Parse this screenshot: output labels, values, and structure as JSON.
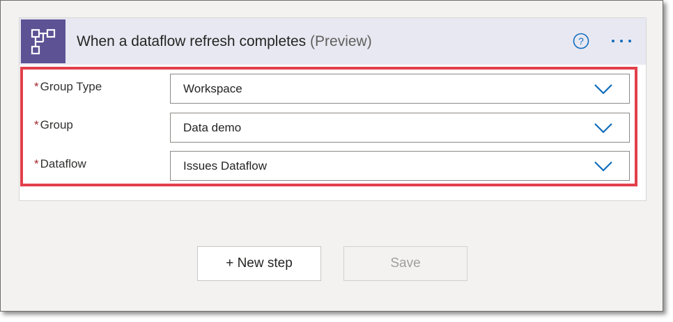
{
  "trigger": {
    "title": "When a dataflow refresh completes",
    "suffix": "(Preview)",
    "icon": "dataflow-hierarchy-icon",
    "icon_bg": "#5c5294"
  },
  "actions": {
    "help_icon": "question-circle-icon",
    "more_icon": "ellipsis-icon"
  },
  "fields": [
    {
      "required_mark": "*",
      "label": "Group Type",
      "value": "Workspace"
    },
    {
      "required_mark": "*",
      "label": "Group",
      "value": "Data demo"
    },
    {
      "required_mark": "*",
      "label": "Dataflow",
      "value": "Issues Dataflow"
    }
  ],
  "buttons": {
    "new_step": "+ New step",
    "save": "Save"
  },
  "colors": {
    "accent": "#0f6cbd",
    "highlight": "#e2404b",
    "header_bg": "#e8e8f2"
  }
}
